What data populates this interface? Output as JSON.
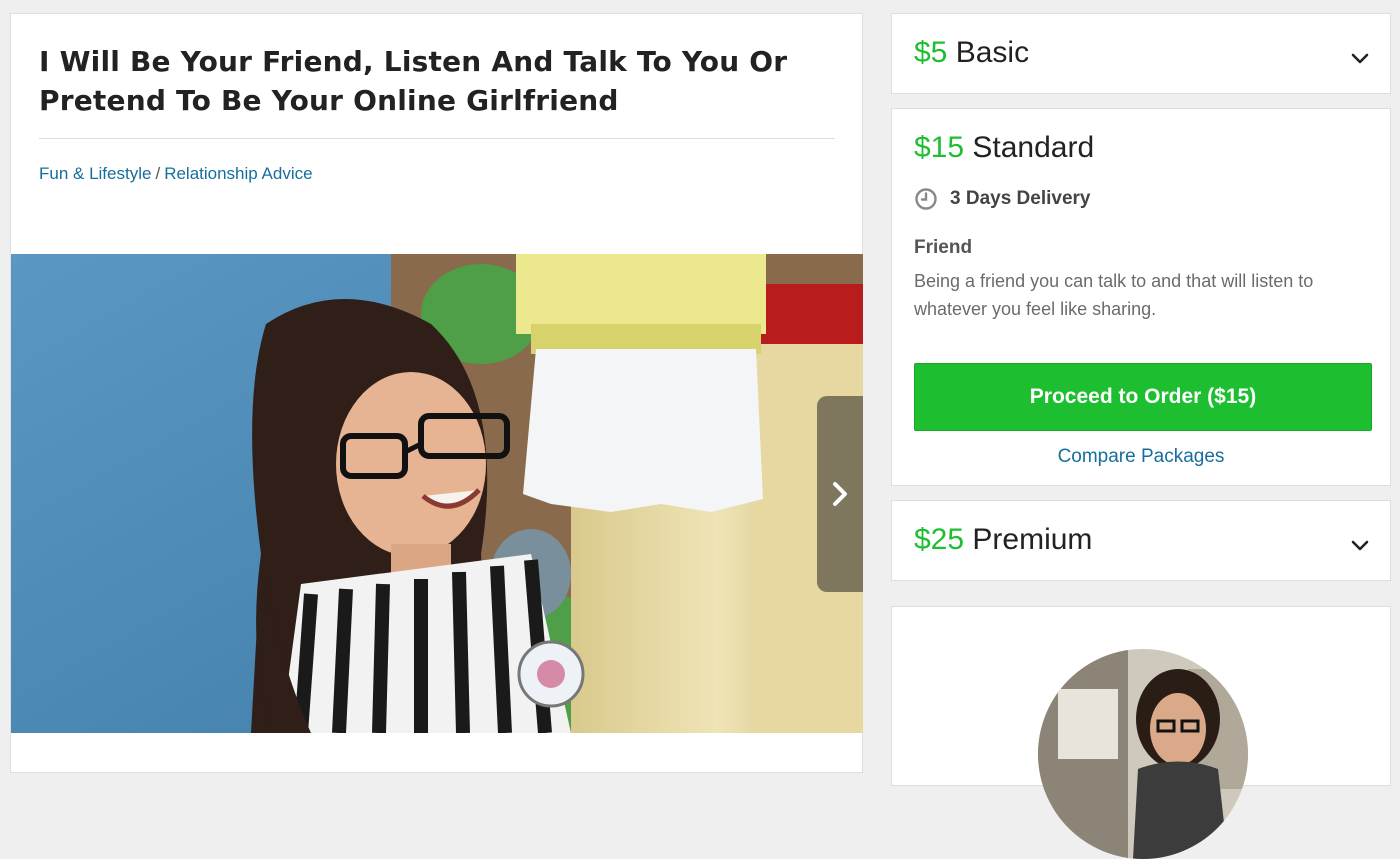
{
  "gig": {
    "title": "I Will Be Your Friend, Listen And Talk To You Or Pretend To Be Your Online Girlfriend",
    "category": "Fun & Lifestyle",
    "separator": "/",
    "subcategory": "Relationship Advice"
  },
  "packages": {
    "basic": {
      "price": "$5",
      "name": "Basic"
    },
    "standard": {
      "price": "$15",
      "name": "Standard",
      "delivery": "3 Days Delivery",
      "title": "Friend",
      "description": "Being a friend you can talk to and that will listen to whatever you feel like sharing.",
      "order_button": "Proceed to Order ($15)",
      "compare_link": "Compare Packages"
    },
    "premium": {
      "price": "$25",
      "name": "Premium"
    }
  },
  "colors": {
    "accent_green": "#1dbf31",
    "link_blue": "#166e9c"
  },
  "icons": {
    "clock": "clock-icon",
    "chevron": "chevron-down-icon",
    "next": "chevron-right-icon"
  }
}
